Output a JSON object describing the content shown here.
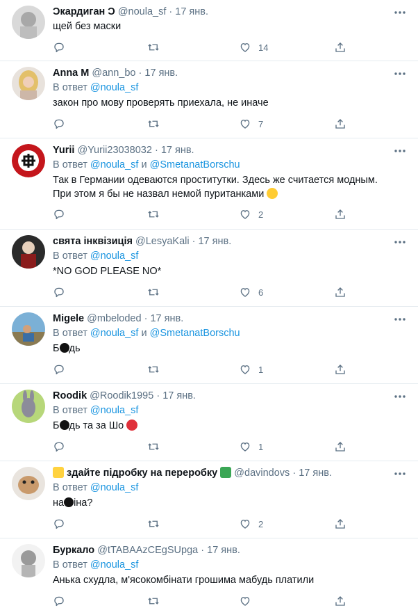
{
  "tweets": [
    {
      "name": "Ɔкардиган Ɔ",
      "handle": "@noula_sf",
      "date": "17 янв.",
      "reply_prefix": "",
      "reply_to": "",
      "reply_and": "",
      "reply_to2": "",
      "text1": "щей без маски",
      "text2": "",
      "likes": "14"
    },
    {
      "name": "Anna M",
      "handle": "@ann_bo",
      "date": "17 янв.",
      "reply_prefix": "В ответ",
      "reply_to": "@noula_sf",
      "reply_and": "",
      "reply_to2": "",
      "text1": "закон про мову проверять приехала, не иначе",
      "text2": "",
      "likes": "7"
    },
    {
      "name": "Yurii",
      "handle": "@Yurii23038032",
      "date": "17 янв.",
      "reply_prefix": "В ответ",
      "reply_to": "@noula_sf",
      "reply_and": "и",
      "reply_to2": "@SmetanatBorschu",
      "text1": "Так в Германии одеваются проститутки. Здесь же считается модным.",
      "text2": "При этом я бы не назвал немой пуританками",
      "likes": "2"
    },
    {
      "name": "свята інквізиція",
      "handle": "@LesyaKali",
      "date": "17 янв.",
      "reply_prefix": "В ответ",
      "reply_to": "@noula_sf",
      "reply_and": "",
      "reply_to2": "",
      "text1": "*NO GOD PLEASE NO*",
      "text2": "",
      "likes": "6"
    },
    {
      "name": "Migele",
      "handle": "@mbeloded",
      "date": "17 янв.",
      "reply_prefix": "В ответ",
      "reply_to": "@noula_sf",
      "reply_and": "и",
      "reply_to2": "@SmetanatBorschu",
      "text1_a": "Б",
      "text1_b": "дь",
      "text2": "",
      "likes": "1"
    },
    {
      "name": "Roodik",
      "handle": "@Roodik1995",
      "date": "17 янв.",
      "reply_prefix": "В ответ",
      "reply_to": "@noula_sf",
      "reply_and": "",
      "reply_to2": "",
      "text1_a": "Б",
      "text1_b": "дь та за Шо",
      "text2": "",
      "likes": "1"
    },
    {
      "name": "здайте підробку на переробку",
      "handle": "@davindovs",
      "date": "17 янв.",
      "reply_prefix": "В ответ",
      "reply_to": "@noula_sf",
      "reply_and": "",
      "reply_to2": "",
      "text1_a": "на",
      "text1_b": "іна?",
      "text2": "",
      "likes": "2"
    },
    {
      "name": "Буркало",
      "handle": "@tTABAAzCEgSUpga",
      "date": "17 янв.",
      "reply_prefix": "В ответ",
      "reply_to": "@noula_sf",
      "reply_and": "",
      "reply_to2": "",
      "text1": "Анька схудла, м'ясокомбінати грошима мабудь платили",
      "text2": "",
      "likes": ""
    }
  ],
  "ui": {
    "dot": "·",
    "link_color": "#1b95e0",
    "muted_color": "#5b7083",
    "divider_color": "#e6ecf0"
  },
  "icons": {
    "more": "more-icon",
    "reply": "reply-icon",
    "retweet": "retweet-icon",
    "like": "heart-icon",
    "share": "share-icon"
  }
}
